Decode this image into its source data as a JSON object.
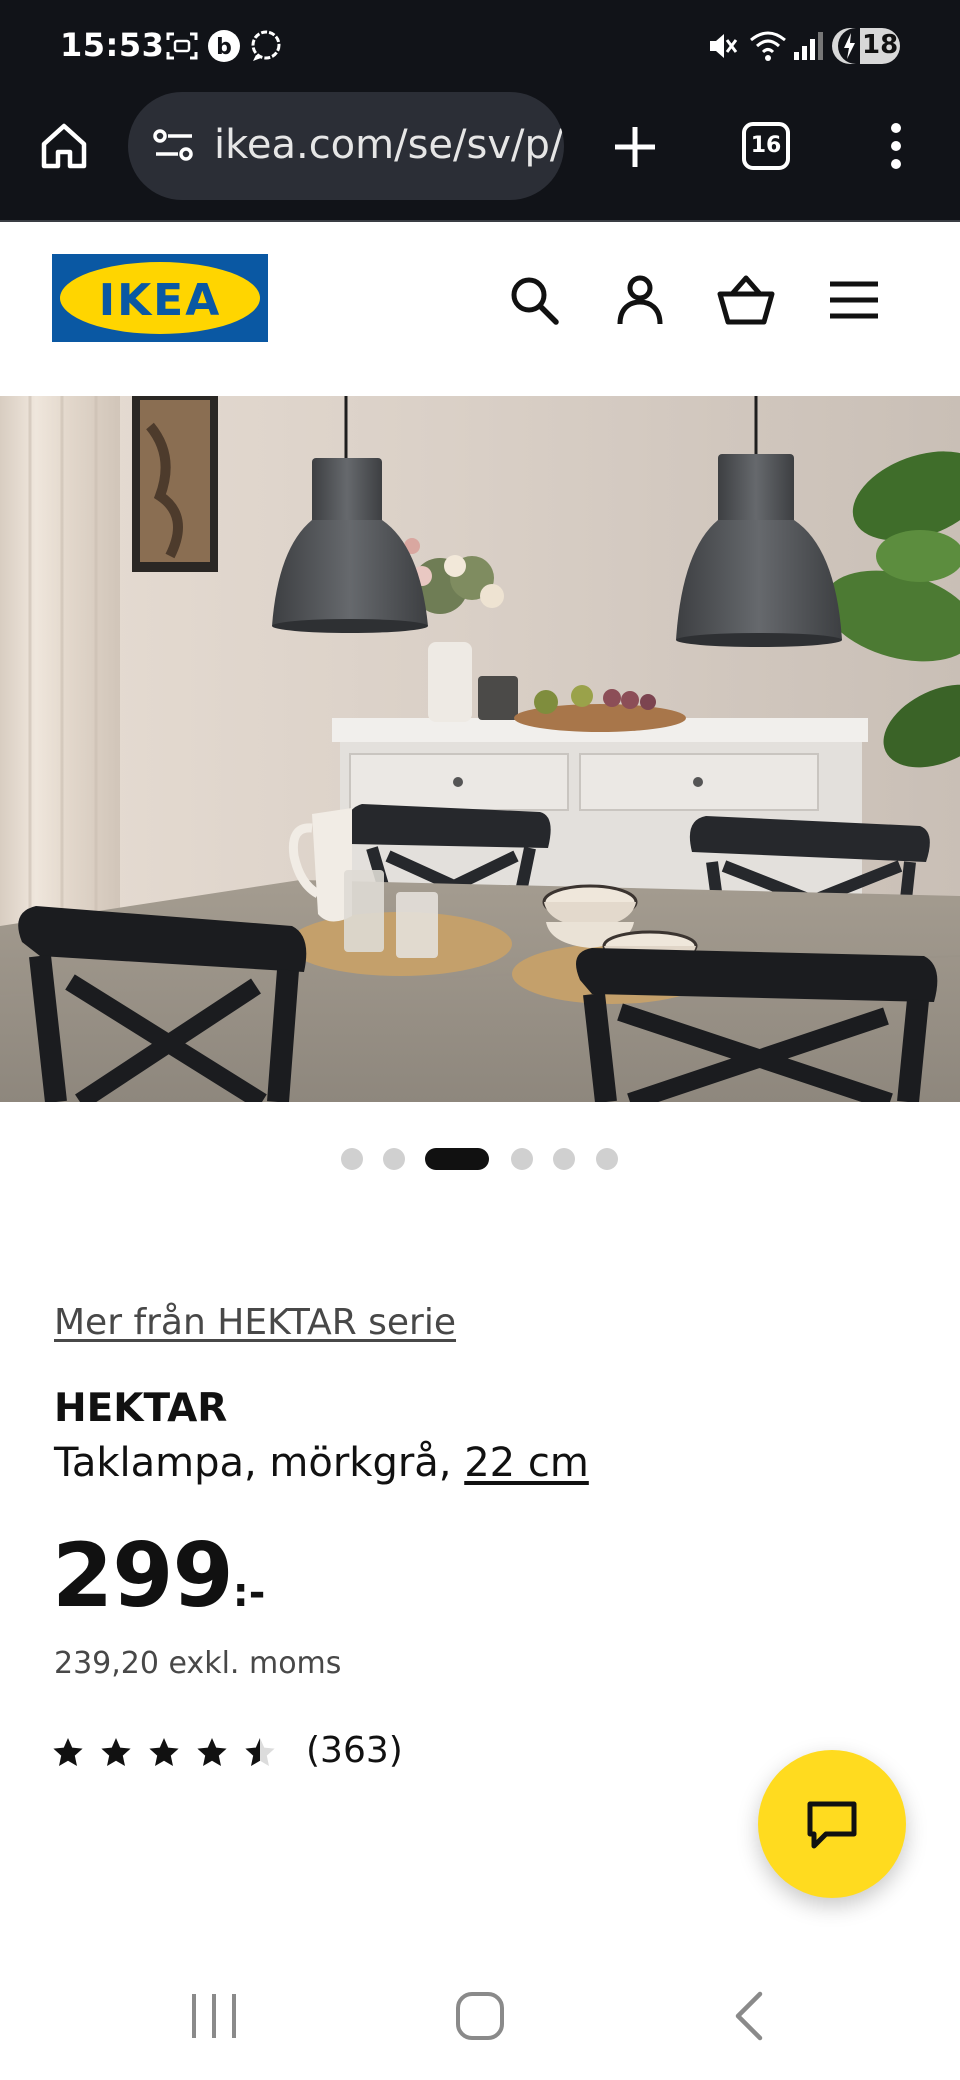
{
  "status_bar": {
    "time": "15:53",
    "battery_level": "18",
    "icons": [
      "screenshot-icon",
      "b-app-icon",
      "chat-bubble-icon",
      "mute-icon",
      "wifi-icon",
      "signal-icon",
      "battery-charging-icon"
    ]
  },
  "browser": {
    "url": "ikea.com/se/sv/p/h",
    "tab_count": "16",
    "icons": [
      "home-icon",
      "site-settings-icon",
      "new-tab-icon",
      "tabs-icon",
      "more-menu-icon"
    ]
  },
  "site_header": {
    "logo_text": "IKEA",
    "icons": [
      "search-icon",
      "account-icon",
      "cart-icon",
      "menu-icon"
    ]
  },
  "gallery": {
    "slide_count": 6,
    "active_index": 2,
    "image": "dining-room-with-two-dark-grey-pendant-lamps"
  },
  "product": {
    "series_link": "Mer från HEKTAR serie",
    "name": "HEKTAR",
    "description": "Taklampa, mörkgrå, ",
    "size": "22 cm",
    "price": "299",
    "price_suffix": ":-",
    "price_excl_vat": "239,20 exkl. moms",
    "rating": 4.5,
    "review_count": "(363)"
  },
  "colors": {
    "ikea_blue": "#0a58a3",
    "ikea_yellow": "#ffd500",
    "chat_button": "#ffdb1f",
    "browser_bar": "#111318"
  }
}
